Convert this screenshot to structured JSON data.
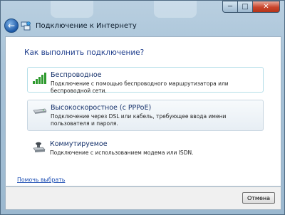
{
  "window": {
    "title": "Подключение к Интернету",
    "minimize_glyph": "─",
    "maximize_glyph": "□",
    "close_glyph": "✕"
  },
  "nav": {
    "back_glyph": "←"
  },
  "main": {
    "question": "Как выполнить подключение?",
    "options": [
      {
        "title": "Беспроводное",
        "description": "Подключение с помощью беспроводного маршрутизатора или беспроводной сети.",
        "icon": "wireless-signal-icon"
      },
      {
        "title": "Высокоскоростное (с PPPoE)",
        "description": "Подключение через DSL или кабель, требующее ввода имени пользователя и пароля.",
        "icon": "broadband-modem-icon"
      },
      {
        "title": "Коммутируемое",
        "description": "Подключение с использованием модема или ISDN.",
        "icon": "dialup-modem-icon"
      }
    ],
    "help_link": "Помочь выбрать"
  },
  "footer": {
    "cancel_label": "Отмена"
  },
  "colors": {
    "heading": "#1f3e8c",
    "link": "#1a4cb3",
    "signal_green": "#2e9a2e"
  }
}
